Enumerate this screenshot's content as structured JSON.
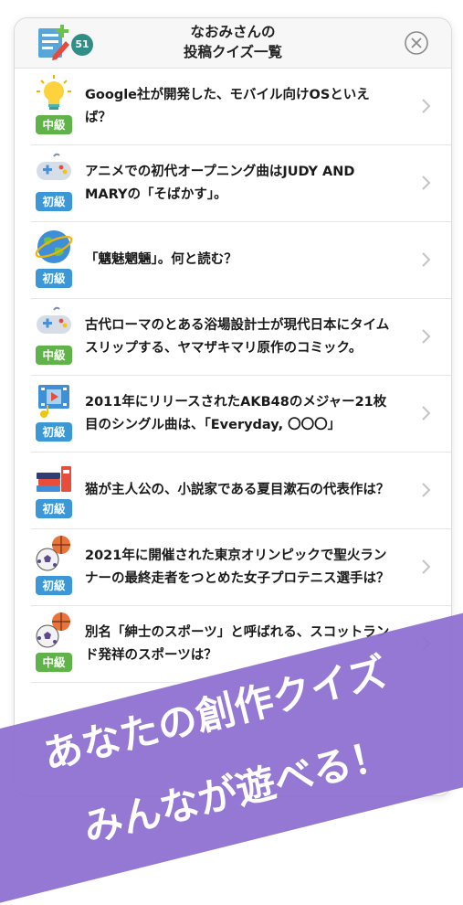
{
  "header": {
    "title_line1": "なおみさんの",
    "title_line2": "投稿クイズ一覧",
    "count": "51"
  },
  "quizzes": [
    {
      "text": "Google社が開発した、モバイル向けOSといえば？",
      "level": "中級",
      "icon": "lightbulb-icon"
    },
    {
      "text": "アニメでの初代オープニング曲はJUDY AND MARYの「そばかす」。",
      "level": "初級",
      "icon": "gamepad-icon"
    },
    {
      "text": "「魑魅魍魎」。何と読む？",
      "level": "初級",
      "icon": "globe-icon"
    },
    {
      "text": "古代ローマのとある浴場設計士が現代日本にタイムスリップする、ヤマザキマリ原作のコミック。",
      "level": "中級",
      "icon": "gamepad-icon"
    },
    {
      "text": "2011年にリリースされたAKB48のメジャー21枚目のシングル曲は、「Everyday, 〇〇〇」",
      "level": "初級",
      "icon": "film-music-icon"
    },
    {
      "text": "猫が主人公の、小説家である夏目漱石の代表作は？",
      "level": "初級",
      "icon": "books-icon"
    },
    {
      "text": "2021年に開催された東京オリンピックで聖火ランナーの最終走者をつとめた女子プロテニス選手は？",
      "level": "初級",
      "icon": "sports-balls-icon"
    },
    {
      "text": "別名「紳士のスポーツ」と呼ばれる、スコットランド発祥のスポーツは？",
      "level": "中級",
      "icon": "sports-balls-icon"
    }
  ],
  "banner": {
    "line1": "あなたの創作クイズ",
    "line2": "みんなが遊べる！"
  }
}
